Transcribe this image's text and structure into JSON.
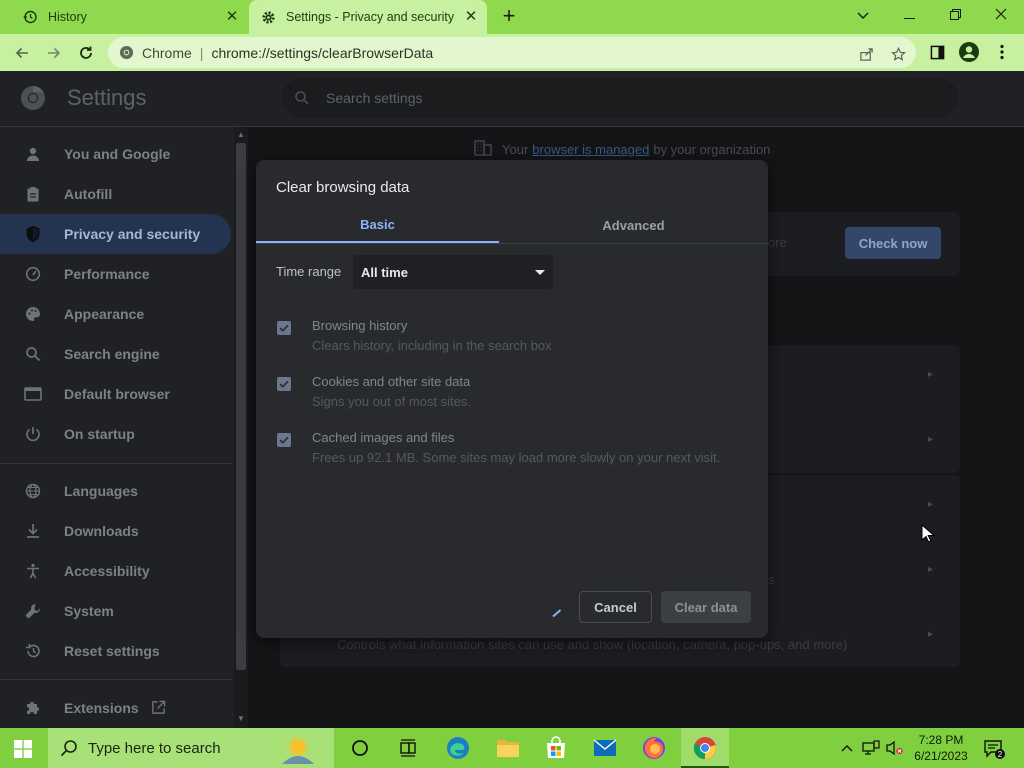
{
  "tabs": [
    {
      "title": "History",
      "icon": "history-icon"
    },
    {
      "title": "Settings - Privacy and security",
      "icon": "settings-gear-icon"
    }
  ],
  "toolbar": {
    "site_name": "Chrome",
    "url": "chrome://settings/clearBrowserData"
  },
  "settings": {
    "title": "Settings",
    "search_placeholder": "Search settings"
  },
  "sidebar": {
    "items": [
      {
        "label": "You and Google",
        "icon": "person-icon"
      },
      {
        "label": "Autofill",
        "icon": "clipboard-icon"
      },
      {
        "label": "Privacy and security",
        "icon": "shield-icon",
        "active": true
      },
      {
        "label": "Performance",
        "icon": "speedometer-icon"
      },
      {
        "label": "Appearance",
        "icon": "palette-icon"
      },
      {
        "label": "Search engine",
        "icon": "search-icon"
      },
      {
        "label": "Default browser",
        "icon": "browser-icon"
      },
      {
        "label": "On startup",
        "icon": "power-icon"
      },
      {
        "label": "Languages",
        "icon": "globe-icon"
      },
      {
        "label": "Downloads",
        "icon": "download-icon"
      },
      {
        "label": "Accessibility",
        "icon": "accessibility-icon"
      },
      {
        "label": "System",
        "icon": "wrench-icon"
      },
      {
        "label": "Reset settings",
        "icon": "reset-icon"
      },
      {
        "label": "Extensions",
        "icon": "puzzle-icon"
      }
    ]
  },
  "main": {
    "managed_prefix": "Your",
    "managed_link": "browser is managed",
    "managed_suffix": "by your organization",
    "check_now": "Check now",
    "safety_fragment": "ore",
    "permissions_desc": "Controls what information sites can use and show (location, camera, pop-ups, and more)",
    "site_settings_fragment": "s"
  },
  "dialog": {
    "title": "Clear browsing data",
    "tab_basic": "Basic",
    "tab_advanced": "Advanced",
    "time_range_label": "Time range",
    "time_range_value": "All time",
    "options": [
      {
        "title": "Browsing history",
        "desc": "Clears history, including in the search box",
        "checked": true
      },
      {
        "title": "Cookies and other site data",
        "desc": "Signs you out of most sites.",
        "checked": true
      },
      {
        "title": "Cached images and files",
        "desc": "Frees up 92.1 MB. Some sites may load more slowly on your next visit.",
        "checked": true
      }
    ],
    "cancel": "Cancel",
    "clear": "Clear data"
  },
  "taskbar": {
    "search_placeholder": "Type here to search",
    "time": "7:28 PM",
    "date": "6/21/2023",
    "notification_count": "2"
  },
  "colors": {
    "tab_strip": "#8fd94f",
    "toolbar": "#c7f0a0",
    "taskbar": "#7fcf3f",
    "accent_blue": "#8ab4f8",
    "dialog_bg": "#292a2d"
  }
}
